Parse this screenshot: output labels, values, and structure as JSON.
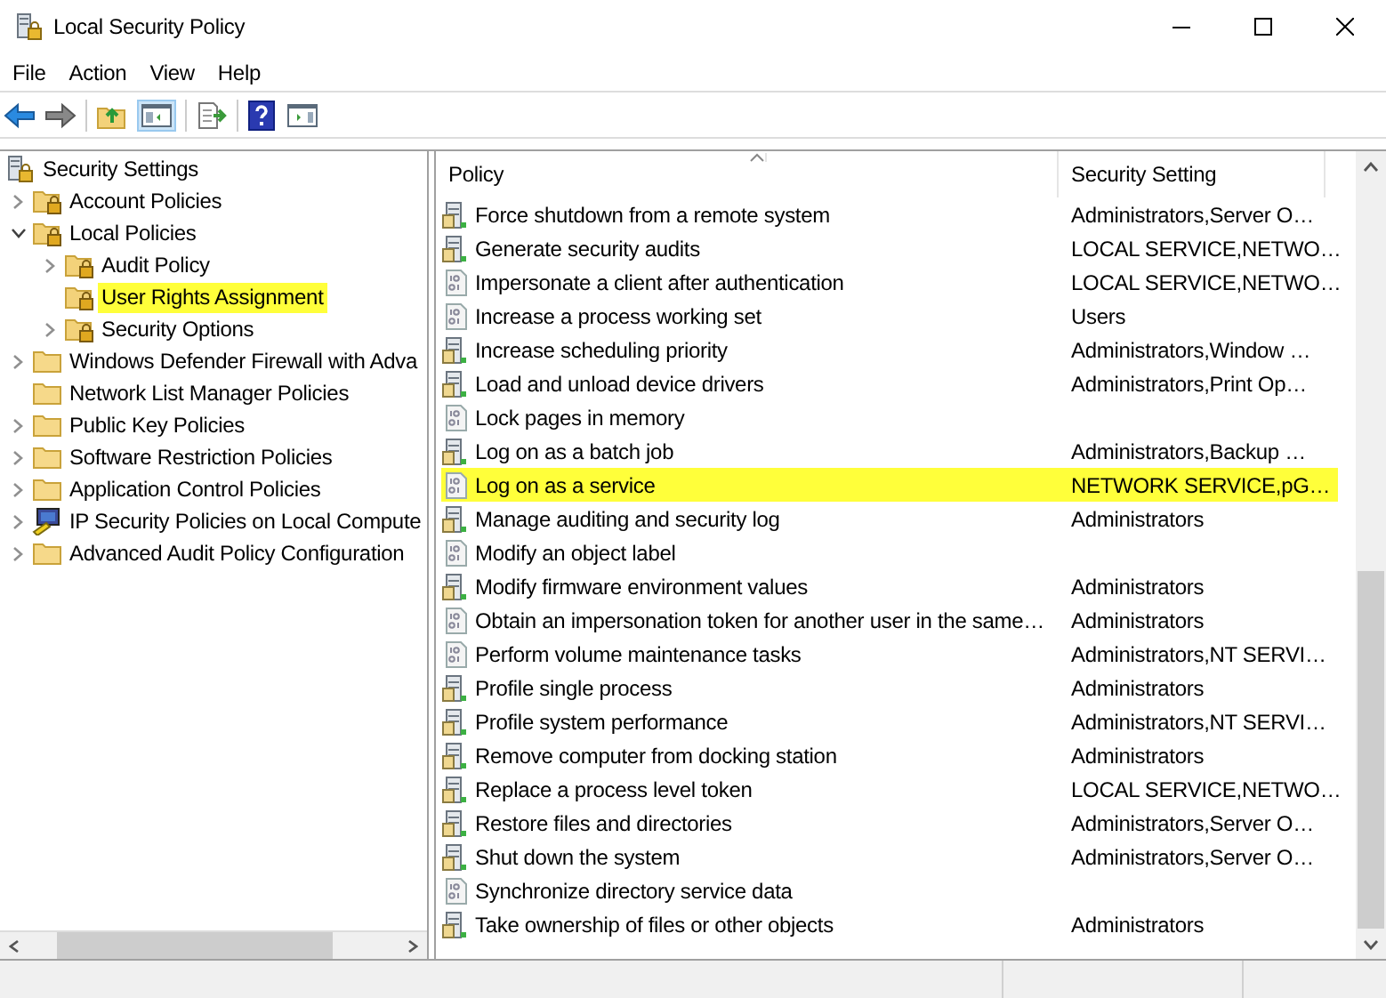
{
  "window": {
    "title": "Local Security Policy"
  },
  "menu": [
    "File",
    "Action",
    "View",
    "Help"
  ],
  "tree": {
    "label": "Security Settings",
    "kind": "root",
    "children": [
      {
        "label": "Account Policies",
        "kind": "locked-folder",
        "expanded": false,
        "selected": false
      },
      {
        "label": "Local Policies",
        "kind": "locked-folder",
        "expanded": true,
        "selected": false,
        "children": [
          {
            "label": "Audit Policy",
            "kind": "locked-folder",
            "expanded": false,
            "selected": false
          },
          {
            "label": "User Rights Assignment",
            "kind": "locked-folder",
            "selected": true
          },
          {
            "label": "Security Options",
            "kind": "locked-folder",
            "expanded": false,
            "selected": false
          }
        ]
      },
      {
        "label": "Windows Defender Firewall with Adva",
        "kind": "folder",
        "expanded": false,
        "selected": false
      },
      {
        "label": "Network List Manager Policies",
        "kind": "folder",
        "selected": false
      },
      {
        "label": "Public Key Policies",
        "kind": "folder",
        "expanded": false,
        "selected": false
      },
      {
        "label": "Software Restriction Policies",
        "kind": "folder",
        "expanded": false,
        "selected": false
      },
      {
        "label": "Application Control Policies",
        "kind": "folder",
        "expanded": false,
        "selected": false
      },
      {
        "label": "IP Security Policies on Local Compute",
        "kind": "ip-security",
        "expanded": false,
        "selected": false
      },
      {
        "label": "Advanced Audit Policy Configuration",
        "kind": "folder",
        "expanded": false,
        "selected": false
      }
    ]
  },
  "table": {
    "columns": [
      "Policy",
      "Security Setting"
    ],
    "rows": [
      {
        "policy": "Force shutdown from a remote system",
        "setting": "Administrators,Server O…",
        "kind": "policy",
        "selected": false
      },
      {
        "policy": "Generate security audits",
        "setting": "LOCAL SERVICE,NETWO…",
        "kind": "policy",
        "selected": false
      },
      {
        "policy": "Impersonate a client after authentication",
        "setting": "LOCAL SERVICE,NETWO…",
        "kind": "binary",
        "selected": false
      },
      {
        "policy": "Increase a process working set",
        "setting": "Users",
        "kind": "binary",
        "selected": false
      },
      {
        "policy": "Increase scheduling priority",
        "setting": "Administrators,Window …",
        "kind": "policy",
        "selected": false
      },
      {
        "policy": "Load and unload device drivers",
        "setting": "Administrators,Print Op…",
        "kind": "policy",
        "selected": false
      },
      {
        "policy": "Lock pages in memory",
        "kind": "binary",
        "selected": false
      },
      {
        "policy": "Log on as a batch job",
        "setting": "Administrators,Backup …",
        "kind": "policy",
        "selected": false
      },
      {
        "policy": "Log on as a service",
        "setting": "NETWORK SERVICE,pG…",
        "kind": "binary",
        "selected": true
      },
      {
        "policy": "Manage auditing and security log",
        "setting": "Administrators",
        "kind": "policy",
        "selected": false
      },
      {
        "policy": "Modify an object label",
        "kind": "binary",
        "selected": false
      },
      {
        "policy": "Modify firmware environment values",
        "setting": "Administrators",
        "kind": "policy",
        "selected": false
      },
      {
        "policy": "Obtain an impersonation token for another user in the same…",
        "setting": "Administrators",
        "kind": "binary",
        "selected": false
      },
      {
        "policy": "Perform volume maintenance tasks",
        "setting": "Administrators,NT SERVI…",
        "kind": "binary",
        "selected": false
      },
      {
        "policy": "Profile single process",
        "setting": "Administrators",
        "kind": "policy",
        "selected": false
      },
      {
        "policy": "Profile system performance",
        "setting": "Administrators,NT SERVI…",
        "kind": "policy",
        "selected": false
      },
      {
        "policy": "Remove computer from docking station",
        "setting": "Administrators",
        "kind": "policy",
        "selected": false
      },
      {
        "policy": "Replace a process level token",
        "setting": "LOCAL SERVICE,NETWO…",
        "kind": "policy",
        "selected": false
      },
      {
        "policy": "Restore files and directories",
        "setting": "Administrators,Server O…",
        "kind": "policy",
        "selected": false
      },
      {
        "policy": "Shut down the system",
        "setting": "Administrators,Server O…",
        "kind": "policy",
        "selected": false
      },
      {
        "policy": "Synchronize directory service data",
        "kind": "binary",
        "selected": false
      },
      {
        "policy": "Take ownership of files or other objects",
        "setting": "Administrators",
        "kind": "policy",
        "selected": false
      }
    ]
  }
}
